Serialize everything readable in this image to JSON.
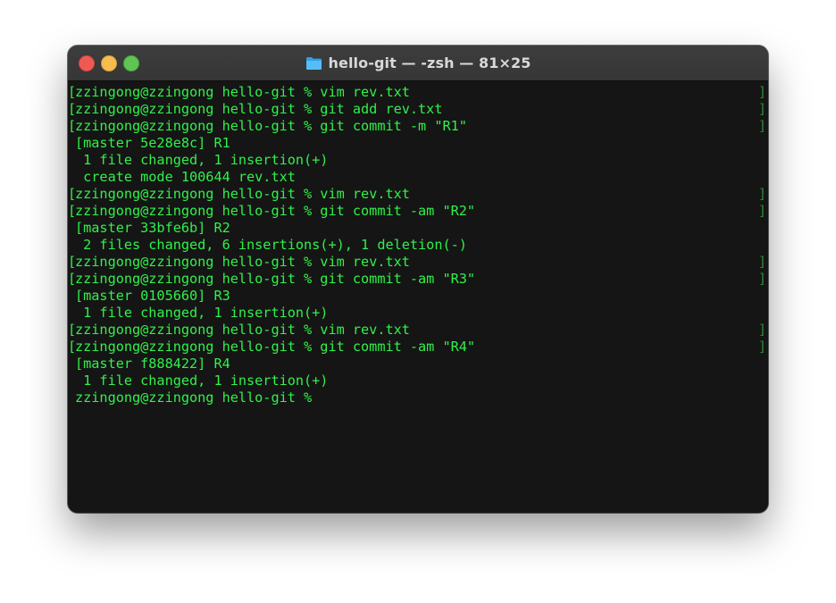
{
  "window": {
    "title": "hello-git — -zsh — 81×25"
  },
  "colors": {
    "terminal_background": "#151515",
    "terminal_text": "#30f14a",
    "titlebar": "#3a3a3a",
    "close": "#ee5a52",
    "minimize": "#f5bd4f",
    "zoom": "#5fc454"
  },
  "icons": {
    "title": "folder-icon"
  },
  "terminal": {
    "lines": [
      {
        "text": "zzingong@zzingong hello-git % vim rev.txt",
        "marked": true
      },
      {
        "text": "zzingong@zzingong hello-git % git add rev.txt",
        "marked": true
      },
      {
        "text": "zzingong@zzingong hello-git % git commit -m \"R1\"",
        "marked": true
      },
      {
        "text": "[master 5e28e8c] R1",
        "marked": false
      },
      {
        "text": " 1 file changed, 1 insertion(+)",
        "marked": false
      },
      {
        "text": " create mode 100644 rev.txt",
        "marked": false
      },
      {
        "text": "zzingong@zzingong hello-git % vim rev.txt",
        "marked": true
      },
      {
        "text": "zzingong@zzingong hello-git % git commit -am \"R2\"",
        "marked": true
      },
      {
        "text": "[master 33bfe6b] R2",
        "marked": false
      },
      {
        "text": " 2 files changed, 6 insertions(+), 1 deletion(-)",
        "marked": false
      },
      {
        "text": "zzingong@zzingong hello-git % vim rev.txt",
        "marked": true
      },
      {
        "text": "zzingong@zzingong hello-git % git commit -am \"R3\"",
        "marked": true
      },
      {
        "text": "[master 0105660] R3",
        "marked": false
      },
      {
        "text": " 1 file changed, 1 insertion(+)",
        "marked": false
      },
      {
        "text": "zzingong@zzingong hello-git % vim rev.txt",
        "marked": true
      },
      {
        "text": "zzingong@zzingong hello-git % git commit -am \"R4\"",
        "marked": true
      },
      {
        "text": "[master f888422] R4",
        "marked": false
      },
      {
        "text": " 1 file changed, 1 insertion(+)",
        "marked": false
      },
      {
        "text": "zzingong@zzingong hello-git %",
        "marked": false
      }
    ]
  }
}
